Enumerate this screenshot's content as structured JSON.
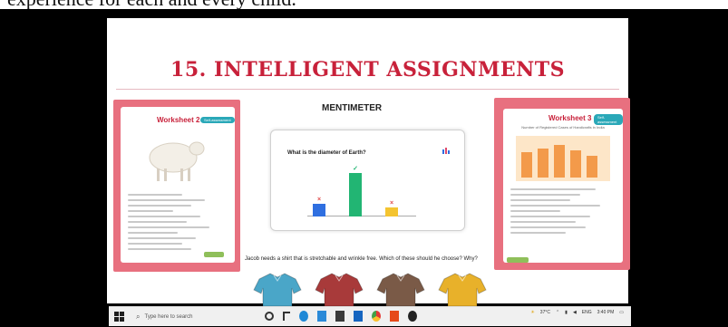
{
  "caption": {
    "text": "experience for each and every child."
  },
  "slide": {
    "title": "15. INTELLIGENT ASSIGNMENTS",
    "mentimeter_label": "MENTIMETER",
    "menti_question": "What is the diameter of Earth?",
    "question_text": "Jacob needs a shirt that is stretchable and wrinkle free. Which of these should he choose? Why?"
  },
  "worksheets": {
    "left": {
      "title": "Worksheet 2",
      "tag": "Self-assessment"
    },
    "right": {
      "title": "Worksheet 3",
      "tag": "Self-assessment",
      "chart_heading": "Number of Registered Cases of Handicrafts in India"
    }
  },
  "menti_chart": {
    "type": "bar",
    "values": [
      3,
      10,
      2
    ],
    "colors": [
      "#2f6fe0",
      "#22b573",
      "#f4c430"
    ],
    "marks": [
      "×",
      "✓",
      "×"
    ]
  },
  "shirts": {
    "colors": [
      "#4aa6c8",
      "#a83a3a",
      "#7a5a47",
      "#e8b12a"
    ]
  },
  "taskbar": {
    "search_placeholder": "Type here to search",
    "temperature": "37°C",
    "time": "3:40 PM"
  }
}
